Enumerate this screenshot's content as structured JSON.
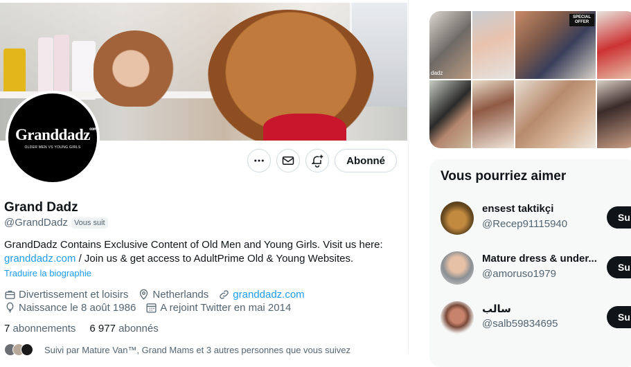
{
  "profile": {
    "avatar_logo": "Granddadz",
    "avatar_logo_sup": "com",
    "avatar_tagline": "OLDER MEN VS YOUNG GIRLS",
    "name": "Grand Dadz",
    "handle": "@GrandDadz",
    "follows_you": "Vous suit",
    "bio_line1": "GrandDadz Contains Exclusive Content of Old Men and Young Girls. Visit us here:",
    "bio_link": "granddadz.com",
    "bio_line2": " / Join us & get access to AdultPrime Old & Young Websites.",
    "translate": "Traduire la biographie",
    "category": "Divertissement et loisirs",
    "location": "Netherlands",
    "website": "granddadz.com",
    "birth": "Naissance le 8 août 1986",
    "joined": "A rejoint Twitter en mai 2014",
    "following_count": "7",
    "following_label": "abonnements",
    "followers_count": "6 977",
    "followers_label": "abonnés",
    "followed_by": "Suivi par Mature Van™, Grand Mams et 3 autres personnes que vous suivez"
  },
  "actions": {
    "more_icon": "more-icon",
    "message_icon": "mail-icon",
    "notify_icon": "bell-plus-icon",
    "follow_label": "Abonné"
  },
  "sidebar": {
    "media_badge": "SPECIAL OFFER",
    "media_watermark": "dadz",
    "whoto_title": "Vous pourriez aimer",
    "suggestions": [
      {
        "name": "ensest taktikçi",
        "handle": "@Recep91115940",
        "button": "Su"
      },
      {
        "name": "Mature dress & under...",
        "handle": "@amoruso1979",
        "button": "Su"
      },
      {
        "name": "سالب",
        "handle": "@salb59834695",
        "button": "Su"
      }
    ]
  },
  "colors": {
    "accent": "#1d9bf0",
    "text": "#0f1419",
    "muted": "#536471",
    "border": "#cfd9de"
  }
}
